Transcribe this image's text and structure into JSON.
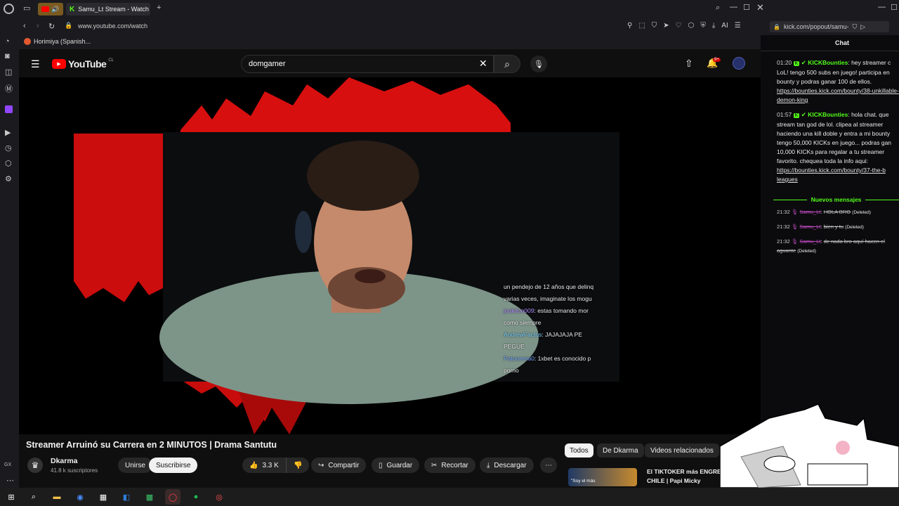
{
  "browser": {
    "tab_title": "Samu_Lt Stream - Watch L",
    "url": "www.youtube.com/watch",
    "bookmark_label": "Horimiya (Spanish...",
    "ai_label": "AI",
    "chat_url": "kick.com/popout/samu-"
  },
  "yt": {
    "logo_text": "YouTube",
    "region": "CL",
    "search_value": "domgamer",
    "notif_count": "9+",
    "video_title": "Streamer Arruinó su Carrera en 2 MINUTOS | Drama Santutu",
    "channel_name": "Dkarma",
    "subscribers": "41.8 k suscriptores",
    "join_label": "Unirse",
    "subscribe_label": "Suscribirse",
    "likes": "3.3 K",
    "share_label": "Compartir",
    "save_label": "Guardar",
    "clip_label": "Recortar",
    "download_label": "Descargar",
    "chips": [
      "Todos",
      "De Dkarma",
      "Videos relacionados"
    ],
    "rec_title_1": "El TIKTOKER más ENGRE",
    "rec_title_2": "CHILE | Papi Micky",
    "rec_thumb_text": "\"Soy el más"
  },
  "overlay_chat": [
    {
      "user": "",
      "text": "un pendejo de 12 años que delinq"
    },
    {
      "user": "",
      "text": "varias veces, imaginate los mogu"
    },
    {
      "user": "joakitoo009",
      "text": ": estas tomando mor"
    },
    {
      "user": "",
      "text": "como siempre"
    },
    {
      "user": "AndrewFactos",
      "text": ": JAJAJAJA PE"
    },
    {
      "user": "",
      "text": "PEGUE"
    },
    {
      "user": "Patoorena0",
      "text": ": 1xbet es conocido p"
    },
    {
      "user": "",
      "text": "porno"
    }
  ],
  "chat": {
    "header": "Chat",
    "divider": "Nuevos mensajes",
    "messages": [
      {
        "time": "01:20",
        "user": "KICKBounties",
        "text": ": hey streamer c LoL! tengo 500 subs en juego! participa en bounty y podras ganar 100 de ellos.",
        "link": "https://bounties.kick.com/bounty/38-unkillable-demon-king"
      },
      {
        "time": "01:57",
        "user": "KICKBounties",
        "text": ": hola chat. que stream tan god de lol. clipea al streamer haciendo una kill doble y entra a mi bounty tengo 50,000 KICKs en juego... podras gan 10,000 KICKs para regalar a tu streamer favorito. chequea toda la info aqui:",
        "link": "https://bounties.kick.com/bounty/37-the-b leagues"
      }
    ],
    "deleted": [
      {
        "time": "21:32",
        "user": "Samu_Lt",
        "text": "HOLA BRO",
        "tag": "(Deleted)"
      },
      {
        "time": "21:32",
        "user": "Samu_Lt",
        "text": "bien y tu",
        "tag": "(Deleted)"
      },
      {
        "time": "21:32",
        "user": "Samu_Lt",
        "text": "de nada bro aquí hacen el aguante",
        "tag": "(Deleted)"
      }
    ]
  },
  "taskbar": {
    "gx_label": "GX"
  },
  "colors": {
    "kick_green": "#53fc18",
    "yt_red": "#ff0000",
    "flame_red": "#e01010"
  }
}
